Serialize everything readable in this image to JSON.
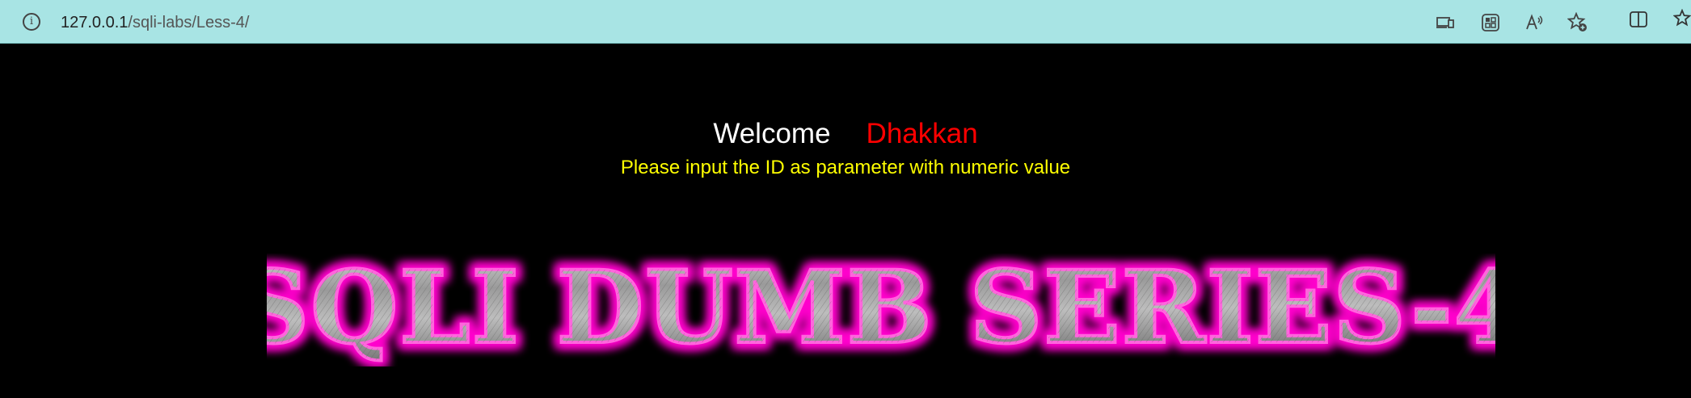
{
  "browser": {
    "url_host": "127.0.0.1",
    "url_path": "/sqli-labs/Less-4/",
    "icons": [
      "info-icon",
      "device-icon",
      "apps-icon",
      "read-aloud-icon",
      "favorite-add-icon",
      "split-screen-icon",
      "favorites-icon"
    ],
    "bar_color": "#a8e4e4"
  },
  "page": {
    "welcome": "Welcome",
    "name": "Dhakkan",
    "instruction": "Please input the ID as parameter with numeric value",
    "banner_text": "SQLI DUMB SERIES-4",
    "colors": {
      "background": "#000000",
      "welcome": "#ffffff",
      "name": "#ff0000",
      "instruction": "#ffff00",
      "banner_glow": "#ff00cc",
      "banner_fill": "#9a9a9a"
    }
  }
}
